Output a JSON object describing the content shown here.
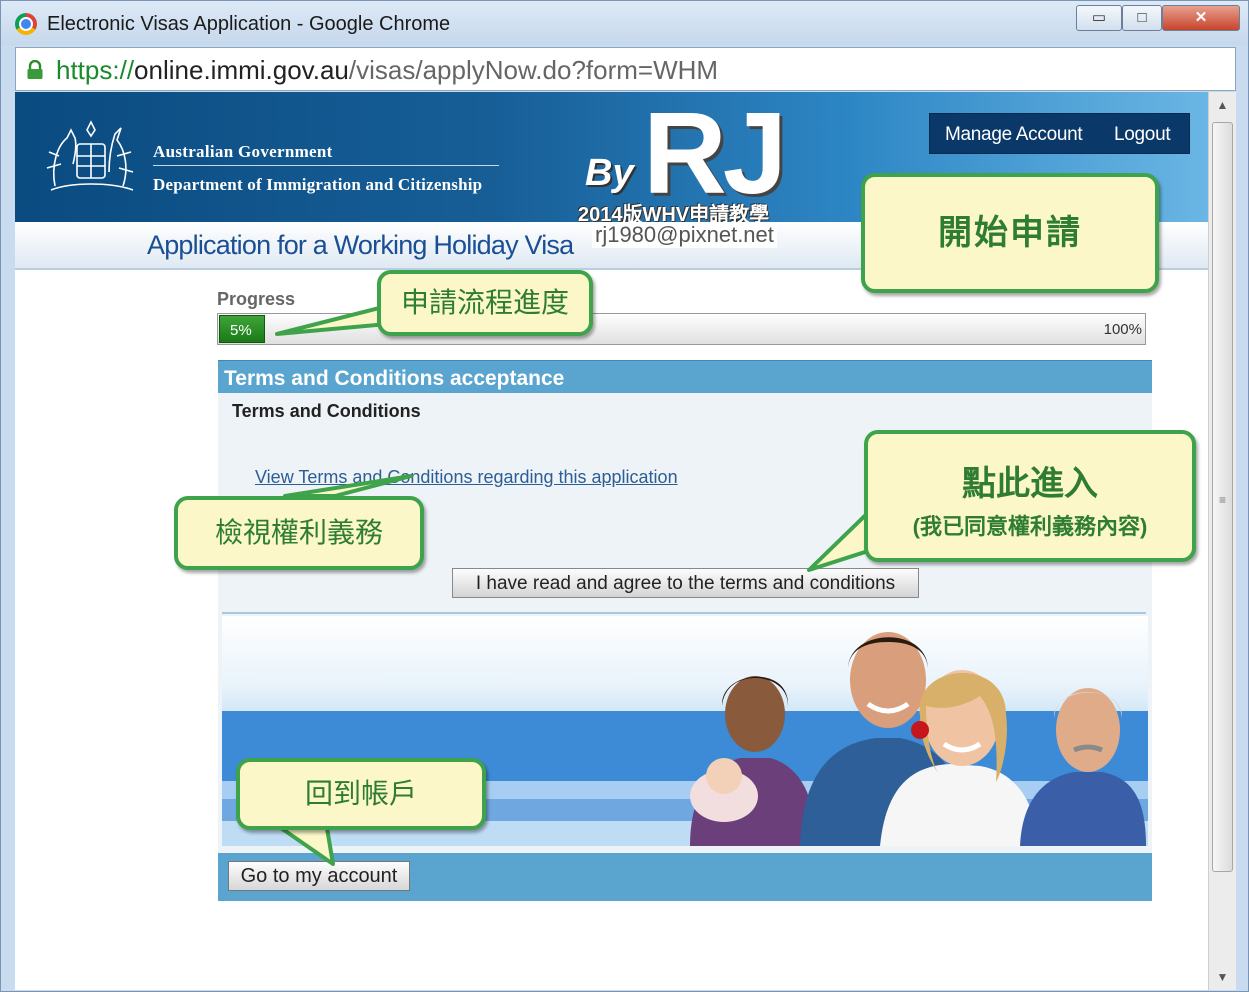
{
  "window": {
    "title": "Electronic Visas Application - Google Chrome",
    "min_symbol": "▭",
    "max_symbol": "□",
    "close_symbol": "✕"
  },
  "address": {
    "scheme": "https://",
    "host": "online.immi.gov.au",
    "path": "/visas/applyNow.do?form=WHM"
  },
  "header": {
    "gov_line1": "Australian Government",
    "gov_line2": "Department of Immigration and Citizenship",
    "manage_account": "Manage Account",
    "logout": "Logout"
  },
  "watermark": {
    "by": "By",
    "rj": "RJ",
    "subtitle": "2014版WHV申請教學",
    "email": "rj1980@pixnet.net"
  },
  "page": {
    "app_title": "Application for a Working Holiday Visa",
    "progress_label": "Progress",
    "progress_value": 5,
    "progress_text": "5%",
    "progress_max_text": "100%"
  },
  "panel": {
    "title": "Terms and Conditions acceptance",
    "heading": "Terms and Conditions",
    "link": "View Terms and Conditions regarding this application",
    "agree_button": "I have read and agree to the terms and conditions",
    "goto_button": "Go to my account"
  },
  "callouts": {
    "start": "開始申請",
    "progress": "申請流程進度",
    "view": "檢視權利義務",
    "enter_line1": "點此進入",
    "enter_line2": "(我已同意權利義務內容)",
    "account": "回到帳戶"
  },
  "colors": {
    "callout_border": "#3ea34a",
    "callout_fill": "#fcf7c8",
    "header_blue": "#175e97",
    "panel_blue": "#5aa4d0",
    "progress_green": "#1a7a17"
  }
}
